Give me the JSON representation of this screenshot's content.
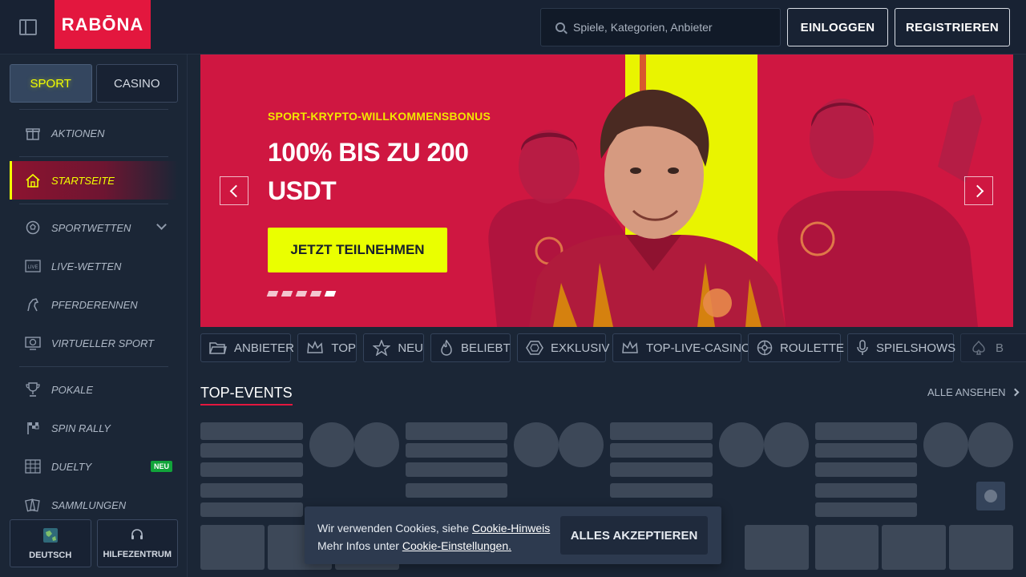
{
  "header": {
    "logo_text": "RABŌNA",
    "search_placeholder": "Spiele, Kategorien, Anbieter",
    "login_label": "EINLOGGEN",
    "register_label": "REGISTRIEREN"
  },
  "sidebar": {
    "tabs": [
      {
        "label": "SPORT",
        "active": true
      },
      {
        "label": "CASINO",
        "active": false
      }
    ],
    "items": [
      {
        "label": "AKTIONEN",
        "icon": "gift-icon"
      },
      {
        "label": "STARTSEITE",
        "icon": "home-icon",
        "active": true
      },
      {
        "label": "SPORTWETTEN",
        "icon": "soccer-ball-icon",
        "expandable": true
      },
      {
        "label": "LIVE-WETTEN",
        "icon": "live-icon"
      },
      {
        "label": "PFERDERENNEN",
        "icon": "horse-icon"
      },
      {
        "label": "VIRTUELLER SPORT",
        "icon": "virtual-sport-icon"
      },
      {
        "label": "POKALE",
        "icon": "trophy-icon"
      },
      {
        "label": "SPIN RALLY",
        "icon": "racing-flag-icon"
      },
      {
        "label": "DUELTY",
        "icon": "duel-icon",
        "badge": "NEU"
      },
      {
        "label": "SAMMLUNGEN",
        "icon": "cards-icon"
      }
    ],
    "bottom": {
      "language_label": "DEUTSCH",
      "help_label": "HILFEZENTRUM"
    }
  },
  "banner": {
    "label": "SPORT-KRYPTO-WILLKOMMENSBONUS",
    "title": "100% BIS ZU 200 USDT",
    "cta_label": "JETZT TEILNEHMEN",
    "slides_count": 5,
    "active_slide": 5,
    "colors": {
      "background": "#cf1741",
      "accent": "#eaff00"
    }
  },
  "categories": [
    {
      "label": "ANBIETER",
      "icon": "folder-icon"
    },
    {
      "label": "TOP",
      "icon": "crown-icon"
    },
    {
      "label": "NEU",
      "icon": "star-icon"
    },
    {
      "label": "BELIEBT",
      "icon": "flame-icon"
    },
    {
      "label": "EXKLUSIV",
      "icon": "diamond-icon"
    },
    {
      "label": "TOP-LIVE-CASINO",
      "icon": "crown-icon"
    },
    {
      "label": "ROULETTE",
      "icon": "roulette-icon"
    },
    {
      "label": "SPIELSHOWS",
      "icon": "microphone-icon"
    },
    {
      "label": "B",
      "icon": "spade-icon"
    }
  ],
  "events": {
    "title": "TOP-EVENTS",
    "see_all_label": "ALLE ANSEHEN"
  },
  "cookie": {
    "line1_prefix": "Wir verwenden Cookies, siehe ",
    "line1_link": "Cookie-Hinweis",
    "line2_prefix": "Mehr Infos unter ",
    "line2_link": "Cookie-Einstellungen.",
    "accept_label": "ALLES AKZEPTIEREN"
  }
}
